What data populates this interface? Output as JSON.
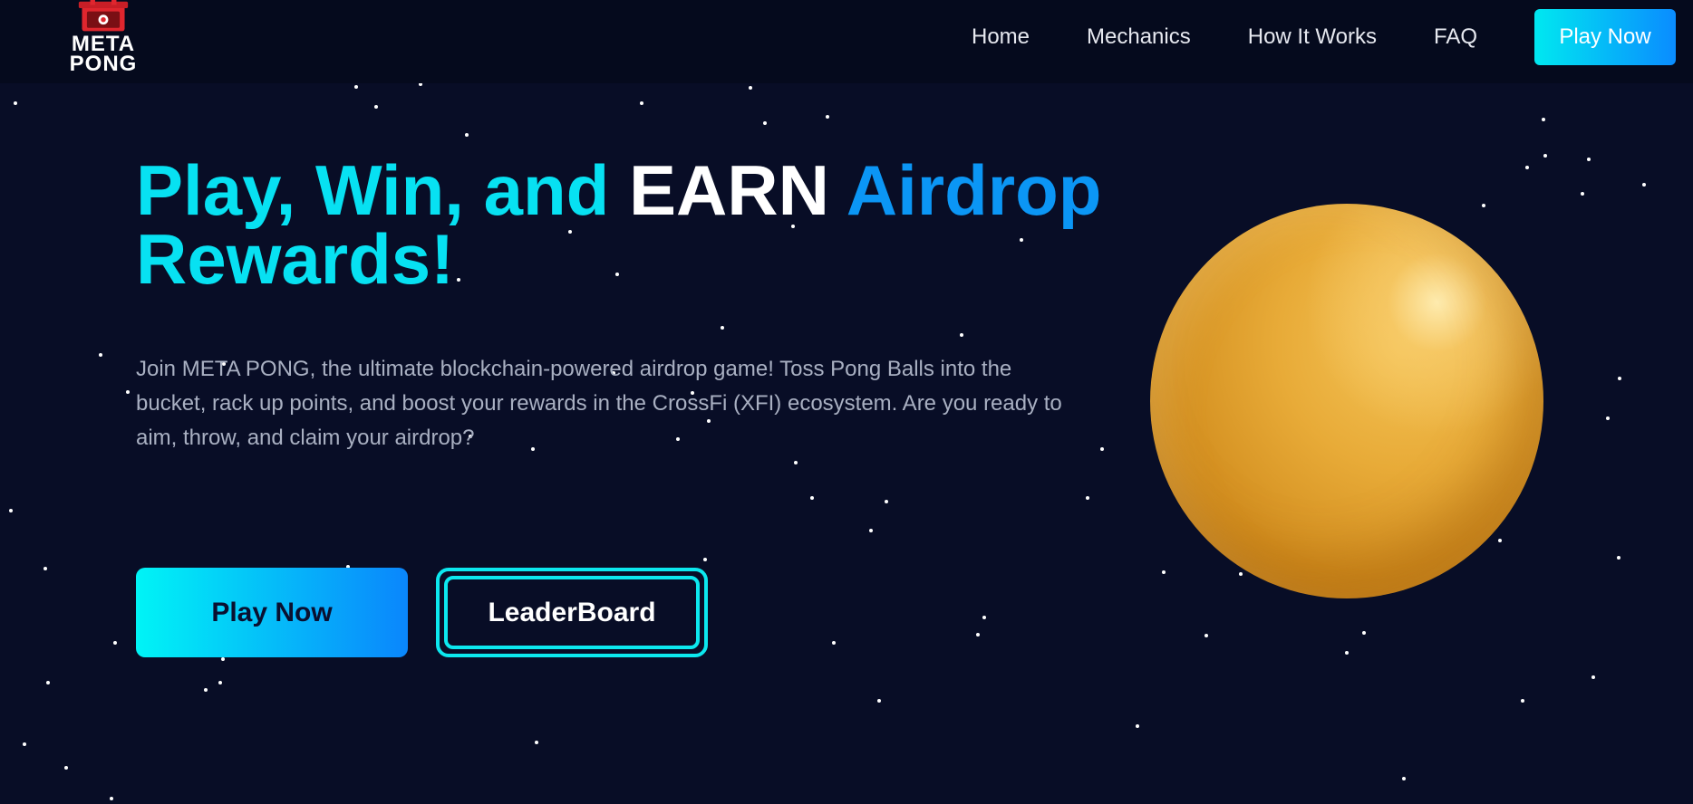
{
  "brand": {
    "logo_text_line1": "META",
    "logo_text_line2": "PONG",
    "logo_icon": "pong-bucket-logo-icon"
  },
  "nav": {
    "links": [
      "Home",
      "Mechanics",
      "How It Works",
      "FAQ"
    ],
    "cta_label": "Play Now"
  },
  "hero": {
    "title_part1": "Play, Win, and ",
    "title_part2": "EARN",
    "title_part3": " Airdrop",
    "title_part4": "Rewards!",
    "description": "Join META PONG, the ultimate blockchain-powered airdrop game! Toss Pong Balls into the bucket, rack up points, and boost your rewards in the CrossFi (XFI) ecosystem. Are you ready to aim, throw, and claim your airdrop?",
    "primary_button": "Play Now",
    "secondary_button": "LeaderBoard",
    "image": "golden-pong-ball"
  },
  "colors": {
    "background": "#080d26",
    "navbar": "#050a1d",
    "accent_cyan": "#07e1f2",
    "accent_blue": "#0b96f5",
    "text_white": "#ffffff",
    "description_text": "#a9b0c2"
  }
}
